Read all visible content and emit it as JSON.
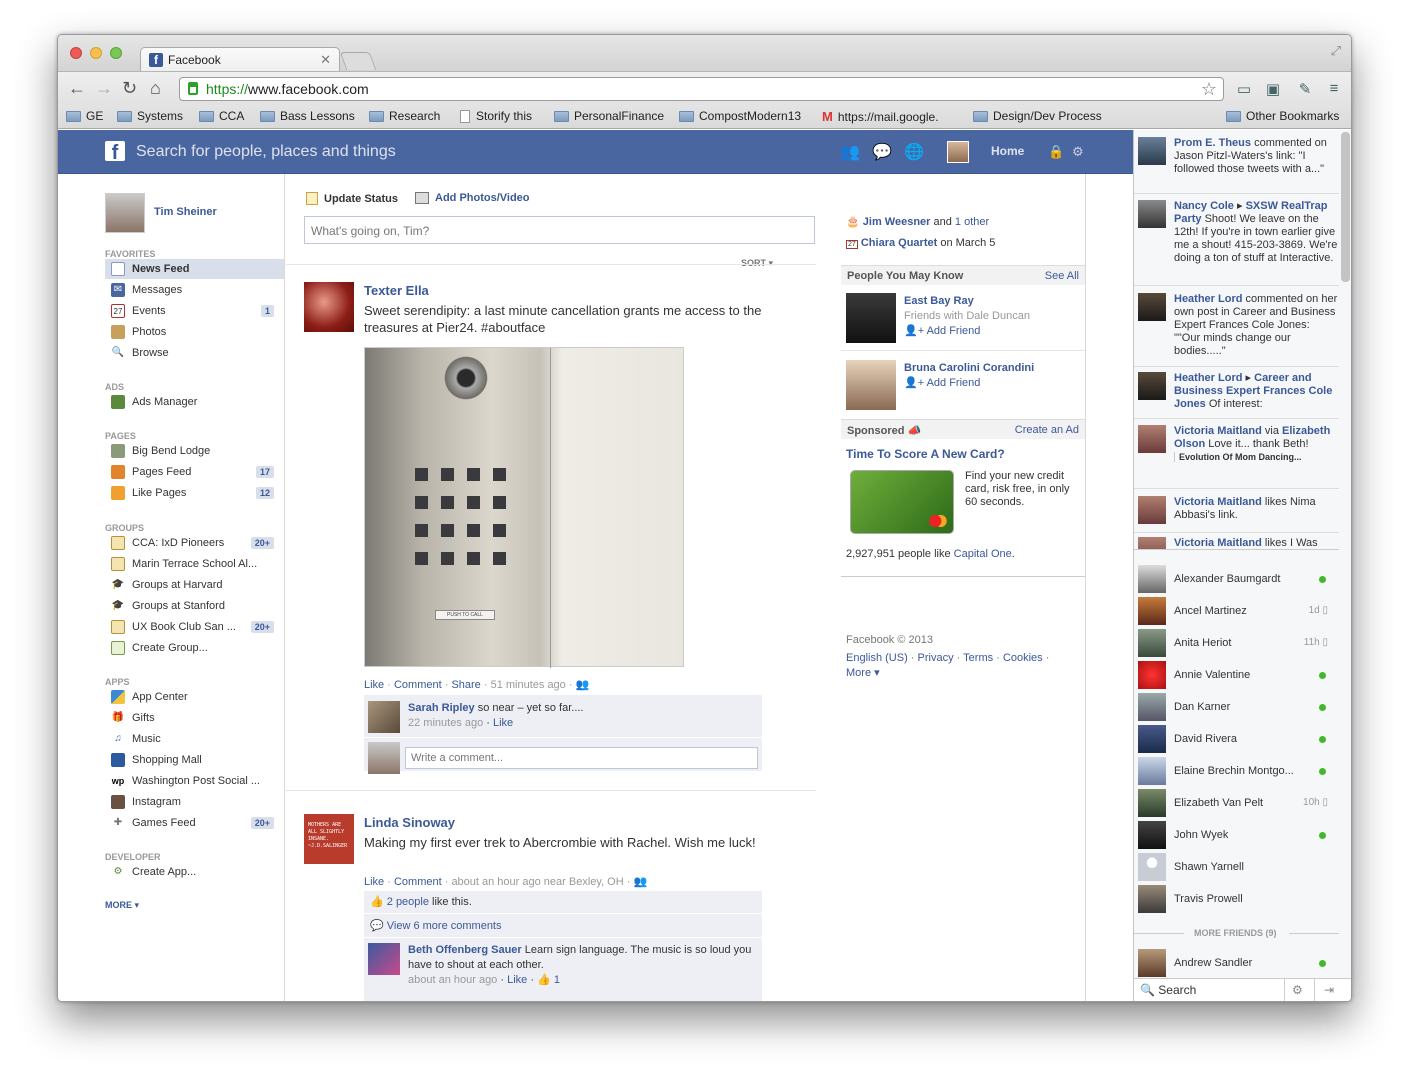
{
  "browser": {
    "tab_title": "Facebook",
    "url_scheme": "https://",
    "url_rest": "www.facebook.com",
    "bookmarks": [
      "GE",
      "Systems",
      "CCA",
      "Bass Lessons",
      "Research",
      "Storify this",
      "PersonalFinance",
      "CompostModern13",
      "https://mail.google.",
      "Design/Dev Process"
    ],
    "other_bookmarks": "Other Bookmarks"
  },
  "fbbar": {
    "search_placeholder": "Search for people, places and things",
    "home": "Home"
  },
  "left": {
    "user_name": "Tim Sheiner",
    "favorites_label": "FAVORITES",
    "favorites": [
      {
        "label": "News Feed",
        "badge": ""
      },
      {
        "label": "Messages",
        "badge": ""
      },
      {
        "label": "Events",
        "badge": "1"
      },
      {
        "label": "Photos",
        "badge": ""
      },
      {
        "label": "Browse",
        "badge": ""
      }
    ],
    "ads_label": "ADS",
    "ads": [
      {
        "label": "Ads Manager",
        "badge": ""
      }
    ],
    "pages_label": "PAGES",
    "pages": [
      {
        "label": "Big Bend Lodge",
        "badge": ""
      },
      {
        "label": "Pages Feed",
        "badge": "17"
      },
      {
        "label": "Like Pages",
        "badge": "12"
      }
    ],
    "groups_label": "GROUPS",
    "groups": [
      {
        "label": "CCA: IxD Pioneers",
        "badge": "20+"
      },
      {
        "label": "Marin Terrace School Al...",
        "badge": ""
      },
      {
        "label": "Groups at Harvard",
        "badge": ""
      },
      {
        "label": "Groups at Stanford",
        "badge": ""
      },
      {
        "label": "UX Book Club San ...",
        "badge": "20+"
      },
      {
        "label": "Create Group...",
        "badge": ""
      }
    ],
    "apps_label": "APPS",
    "apps": [
      {
        "label": "App Center",
        "badge": ""
      },
      {
        "label": "Gifts",
        "badge": ""
      },
      {
        "label": "Music",
        "badge": ""
      },
      {
        "label": "Shopping Mall",
        "badge": ""
      },
      {
        "label": "Washington Post Social ...",
        "badge": ""
      },
      {
        "label": "Instagram",
        "badge": ""
      },
      {
        "label": "Games Feed",
        "badge": "20+"
      }
    ],
    "developer_label": "DEVELOPER",
    "developer": [
      {
        "label": "Create App...",
        "badge": ""
      }
    ],
    "more": "MORE"
  },
  "composer": {
    "update_status": "Update Status",
    "add_photos": "Add Photos/Video",
    "placeholder": "What's going on, Tim?",
    "sort": "SORT"
  },
  "posts": [
    {
      "author": "Texter Ella",
      "text": "Sweet serendipity: a last minute cancellation grants me access to the treasures at Pier24. #aboutface",
      "photo_caption": "PUSH TO CALL",
      "like": "Like",
      "comment": "Comment",
      "share": "Share",
      "time": "51 minutes ago",
      "comments": [
        {
          "author": "Sarah Ripley",
          "text": "so near – yet so far....",
          "meta_time": "22 minutes ago",
          "meta_like": "Like"
        }
      ],
      "write_comment": "Write a comment..."
    },
    {
      "author": "Linda Sinoway",
      "avatar_text": "MOTHERS ARE ALL SLIGHTLY INSANE. ~J.D.SALINGER",
      "text": "Making my first ever trek to Abercrombie with Rachel. Wish me luck!",
      "like": "Like",
      "comment": "Comment",
      "time": "about an hour ago near Bexley, OH",
      "likes_count": "2 people",
      "likes_suffix": "like this.",
      "view_more": "View 6 more comments",
      "comments": [
        {
          "author": "Beth Offenberg Sauer",
          "text": "Learn sign language. The music is so loud you have to shout at each other.",
          "meta_time": "about an hour ago",
          "meta_like": "Like",
          "meta_count": "1"
        }
      ]
    }
  ],
  "right": {
    "birthdays": [
      {
        "name": "Jim Weesner",
        "rest": "and",
        "other": "1 other"
      },
      {
        "name": "Chiara Quartet",
        "rest": "on March 5"
      }
    ],
    "pymk_title": "People You May Know",
    "see_all": "See All",
    "pymk": [
      {
        "name": "East Bay Ray",
        "sub": "Friends with Dale Duncan",
        "action": "Add Friend"
      },
      {
        "name": "Bruna Carolini Corandini",
        "sub": "",
        "action": "Add Friend"
      }
    ],
    "sponsored": "Sponsored",
    "create_ad": "Create an Ad",
    "ad_title": "Time To Score A New Card?",
    "ad_text": "Find your new credit card, risk free, in only 60 seconds.",
    "ad_likes": "2,927,951 people like",
    "ad_brand": "Capital One",
    "footer_copy": "Facebook © 2013",
    "footer_links": [
      "English (US)",
      "Privacy",
      "Terms",
      "Cookies"
    ],
    "footer_more": "More"
  },
  "ticker": [
    {
      "html_a": "Prom E. Theus",
      "rest": "commented on Jason Pitzl-Waters's link: \"I followed those tweets with a...\""
    },
    {
      "html_a": "Nancy Cole",
      "sep": "▸",
      "html_b": "SXSW RealTrap Party",
      "rest": "Shoot! We leave on the 12th! If you're in town earlier give me a shout! 415-203-3869. We're doing a ton of stuff at Interactive."
    },
    {
      "html_a": "Heather Lord",
      "rest": "commented on her own post in Career and Business Expert Frances Cole Jones: \"\"Our minds change our bodies.....\""
    },
    {
      "html_a": "Heather Lord",
      "sep": "▸",
      "html_b": "Career and Business Expert Frances Cole Jones",
      "rest": "Of interest:"
    },
    {
      "html_a": "Victoria Maitland",
      "rest": "via",
      "html_b": "Elizabeth Olson",
      "rest2": "Love it... thank Beth!",
      "sub": "Evolution Of Mom Dancing..."
    },
    {
      "html_a": "Victoria Maitland",
      "rest": "likes Nima Abbasi's link."
    },
    {
      "html_a": "Victoria Maitland",
      "rest": "likes I Was"
    }
  ],
  "friends": [
    {
      "name": "Alexander Baumgardt",
      "status": "online",
      "time": ""
    },
    {
      "name": "Ancel Martinez",
      "status": "mobile",
      "time": "1d"
    },
    {
      "name": "Anita Heriot",
      "status": "mobile",
      "time": "11h"
    },
    {
      "name": "Annie Valentine",
      "status": "online",
      "time": ""
    },
    {
      "name": "Dan Karner",
      "status": "online",
      "time": ""
    },
    {
      "name": "David Rivera",
      "status": "online",
      "time": ""
    },
    {
      "name": "Elaine Brechin Montgo...",
      "status": "online",
      "time": ""
    },
    {
      "name": "Elizabeth Van Pelt",
      "status": "mobile",
      "time": "10h"
    },
    {
      "name": "John Wyek",
      "status": "online",
      "time": ""
    },
    {
      "name": "Shawn Yarnell",
      "status": "",
      "time": ""
    },
    {
      "name": "Travis Prowell",
      "status": "",
      "time": ""
    }
  ],
  "more_friends": "MORE FRIENDS (9)",
  "more_friends_list": [
    {
      "name": "Andrew Sandler",
      "status": "online",
      "time": ""
    }
  ],
  "chat_search": "Search",
  "colors": {
    "fb_blue": "#3b5998",
    "bar_blue": "#4a66a0",
    "online_green": "#42b72a"
  }
}
